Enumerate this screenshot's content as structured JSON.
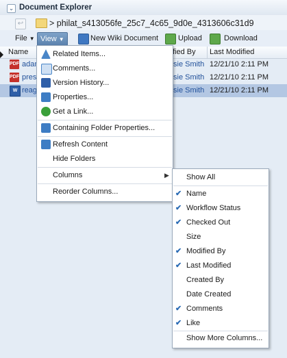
{
  "panel": {
    "title": "Document Explorer"
  },
  "path": {
    "text": "> philat_s413056fe_25c7_4c65_9d0e_4313606c31d9"
  },
  "toolbar": {
    "file_label": "File",
    "view_label": "View",
    "new_wiki_label": "New Wiki Document",
    "upload_label": "Upload",
    "download_label": "Download"
  },
  "table": {
    "headers": {
      "name": "Name",
      "modified_by": "fied By",
      "last_modified": "Last Modified"
    },
    "rows": [
      {
        "name": "adam",
        "modified_by": "sie Smith",
        "last_modified": "12/21/10 2:11 PM",
        "icon": "pdf-icon",
        "selected": false
      },
      {
        "name": "pres",
        "modified_by": "sie Smith",
        "last_modified": "12/21/10 2:11 PM",
        "icon": "pdf-icon",
        "selected": false
      },
      {
        "name": "reag",
        "modified_by": "sie Smith",
        "last_modified": "12/21/10 2:11 PM",
        "icon": "word-icon",
        "selected": true
      }
    ]
  },
  "view_menu": {
    "related_items": "Related Items...",
    "comments": "Comments...",
    "version_history": "Version History...",
    "properties": "Properties...",
    "get_link": "Get a Link...",
    "containing_folder": "Containing Folder Properties...",
    "refresh": "Refresh Content",
    "hide_folders": "Hide Folders",
    "columns": "Columns",
    "reorder_columns": "Reorder Columns..."
  },
  "columns_menu": {
    "show_all": "Show All",
    "items": [
      {
        "label": "Name",
        "checked": true
      },
      {
        "label": "Workflow Status",
        "checked": true
      },
      {
        "label": "Checked Out",
        "checked": true
      },
      {
        "label": "Size",
        "checked": false
      },
      {
        "label": "Modified By",
        "checked": true
      },
      {
        "label": "Last Modified",
        "checked": true
      },
      {
        "label": "Created By",
        "checked": false
      },
      {
        "label": "Date Created",
        "checked": false
      },
      {
        "label": "Comments",
        "checked": true
      },
      {
        "label": "Like",
        "checked": true
      }
    ],
    "show_more": "Show More Columns..."
  },
  "colors": {
    "accent": "#2a6bb4",
    "selected_row": "#b3c7e3",
    "toolbar_active": "#5b82ad"
  }
}
